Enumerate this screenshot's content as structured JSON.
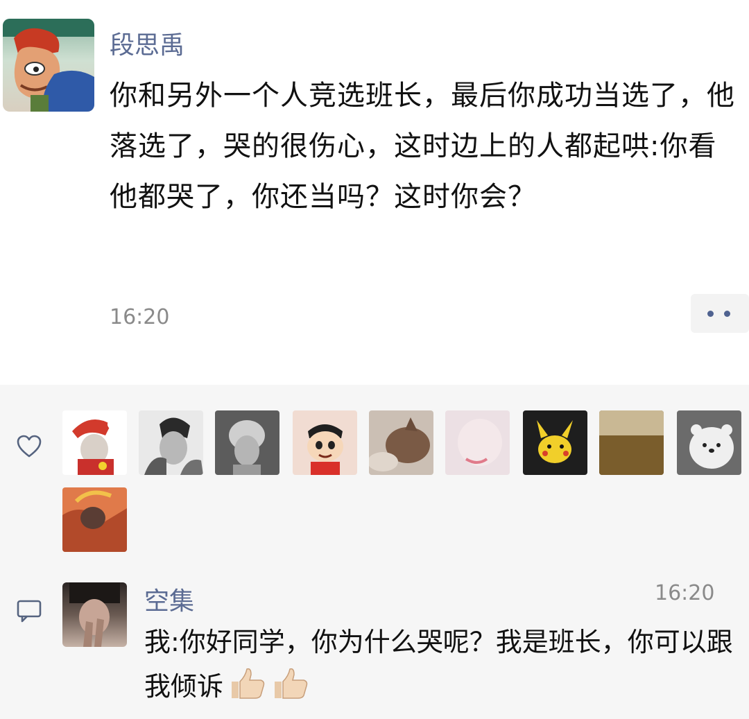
{
  "post": {
    "author": "段思禹",
    "content": "你和另外一个人竞选班长，最后你成功当选了，他落选了，哭的很伤心，这时边上的人都起哄:你看他都哭了，你还当吗？这时你会？",
    "time": "16:20",
    "more_icon": "more-dots-icon"
  },
  "likes": {
    "icon": "heart-icon",
    "avatars": [
      {
        "name": "like-avatar-1",
        "color": "#c9302c"
      },
      {
        "name": "like-avatar-2",
        "color": "#9a9a9a"
      },
      {
        "name": "like-avatar-3",
        "color": "#8c8c8c"
      },
      {
        "name": "like-avatar-4",
        "color": "#e8b8a6"
      },
      {
        "name": "like-avatar-5",
        "color": "#8a6a52"
      },
      {
        "name": "like-avatar-6",
        "color": "#e0cfd3"
      },
      {
        "name": "like-avatar-7",
        "color": "#e6c42a"
      },
      {
        "name": "like-avatar-8",
        "color": "#8a6a2e"
      },
      {
        "name": "like-avatar-9",
        "color": "#bcbcbc"
      },
      {
        "name": "like-avatar-10",
        "color": "#b05a3a"
      }
    ]
  },
  "comments": [
    {
      "author": "空集",
      "time": "16:20",
      "text": "我:你好同学，你为什么哭呢？我是班长，你可以跟我倾诉",
      "emoji": [
        "thumbs-up-icon",
        "thumbs-up-icon"
      ]
    }
  ],
  "colors": {
    "name_blue": "#5b6b93",
    "time_gray": "#8a8a8a",
    "panel_bg": "#f6f6f6"
  }
}
